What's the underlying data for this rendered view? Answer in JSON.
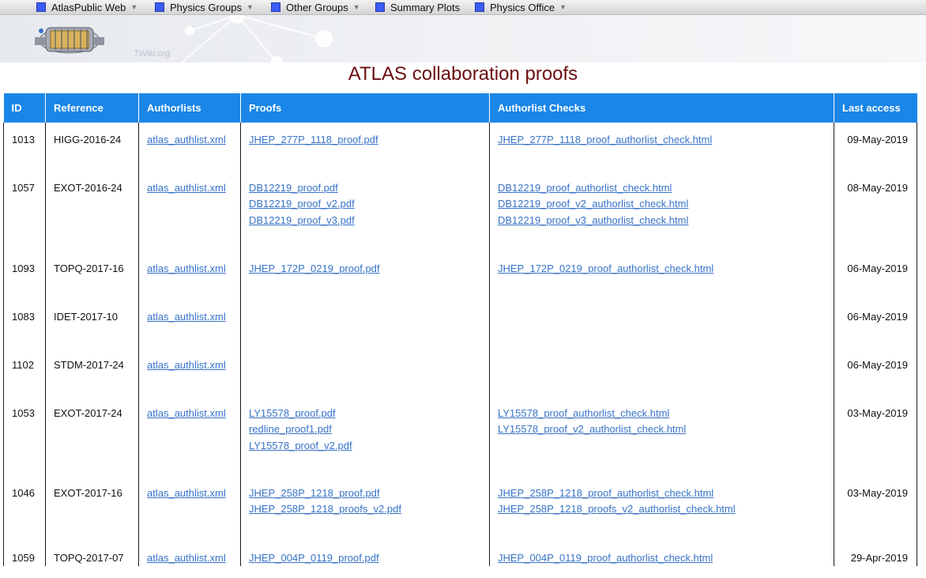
{
  "menu": [
    {
      "label": "AtlasPublic Web",
      "has_dropdown": true
    },
    {
      "label": "Physics Groups",
      "has_dropdown": true
    },
    {
      "label": "Other Groups",
      "has_dropdown": true
    },
    {
      "label": "Summary Plots",
      "has_dropdown": false
    },
    {
      "label": "Physics Office",
      "has_dropdown": true
    }
  ],
  "banner": {
    "twiki_label": "TWiki.org"
  },
  "page_title": "ATLAS collaboration proofs",
  "table": {
    "headers": [
      "ID",
      "Reference",
      "Authorlists",
      "Proofs",
      "Authorlist Checks",
      "Last access"
    ],
    "rows": [
      {
        "id": "1013",
        "reference": "HIGG-2016-24",
        "authorlist": "atlas_authlist.xml",
        "proofs": [
          "JHEP_277P_1118_proof.pdf"
        ],
        "checks": [
          "JHEP_277P_1118_proof_authorlist_check.html"
        ],
        "last_access": "09-May-2019"
      },
      {
        "id": "1057",
        "reference": "EXOT-2016-24",
        "authorlist": "atlas_authlist.xml",
        "proofs": [
          "DB12219_proof.pdf",
          "DB12219_proof_v2.pdf",
          "DB12219_proof_v3.pdf"
        ],
        "checks": [
          "DB12219_proof_authorlist_check.html",
          "DB12219_proof_v2_authorlist_check.html",
          "DB12219_proof_v3_authorlist_check.html"
        ],
        "last_access": "08-May-2019"
      },
      {
        "id": "1093",
        "reference": "TOPQ-2017-16",
        "authorlist": "atlas_authlist.xml",
        "proofs": [
          "JHEP_172P_0219_proof.pdf"
        ],
        "checks": [
          "JHEP_172P_0219_proof_authorlist_check.html"
        ],
        "last_access": "06-May-2019"
      },
      {
        "id": "1083",
        "reference": "IDET-2017-10",
        "authorlist": "atlas_authlist.xml",
        "proofs": [],
        "checks": [],
        "last_access": "06-May-2019"
      },
      {
        "id": "1102",
        "reference": "STDM-2017-24",
        "authorlist": "atlas_authlist.xml",
        "proofs": [],
        "checks": [],
        "last_access": "06-May-2019"
      },
      {
        "id": "1053",
        "reference": "EXOT-2017-24",
        "authorlist": "atlas_authlist.xml",
        "proofs": [
          "LY15578_proof.pdf",
          "redline_proof1.pdf",
          "LY15578_proof_v2.pdf"
        ],
        "checks": [
          "LY15578_proof_authorlist_check.html",
          "LY15578_proof_v2_authorlist_check.html"
        ],
        "last_access": "03-May-2019"
      },
      {
        "id": "1046",
        "reference": "EXOT-2017-16",
        "authorlist": "atlas_authlist.xml",
        "proofs": [
          "JHEP_258P_1218_proof.pdf",
          "JHEP_258P_1218_proofs_v2.pdf"
        ],
        "checks": [
          "JHEP_258P_1218_proof_authorlist_check.html",
          "JHEP_258P_1218_proofs_v2_authorlist_check.html"
        ],
        "last_access": "03-May-2019"
      },
      {
        "id": "1059",
        "reference": "TOPQ-2017-07",
        "authorlist": "atlas_authlist.xml",
        "proofs": [
          "JHEP_004P_0119_proof.pdf"
        ],
        "checks": [
          "JHEP_004P_0119_proof_authorlist_check.html"
        ],
        "last_access": "29-Apr-2019"
      }
    ]
  }
}
